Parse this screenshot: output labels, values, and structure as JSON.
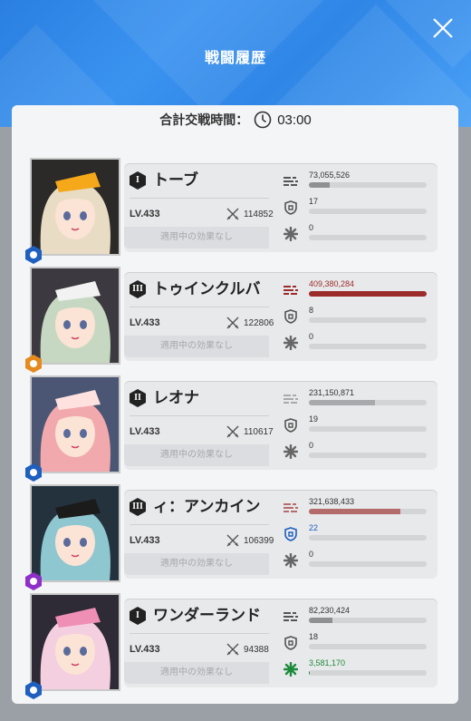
{
  "header": {
    "title": "戦闘履歴"
  },
  "summary": {
    "label": "合計交戦時間：",
    "time": "03:00"
  },
  "effect_text": "適用中の効果なし",
  "rows": [
    {
      "burst": "I",
      "name": "トーブ",
      "level": "LV.433",
      "power": "114852",
      "element": {
        "icon": "water-drop-icon",
        "color": "#1e5fbf"
      },
      "portrait": {
        "bg": "#2b2a28",
        "hair": "#e9dcc4",
        "accent": "#f4a81a"
      },
      "damage": {
        "value": "73,055,526",
        "fill": 0.18,
        "color": "#8f9093"
      },
      "taken": {
        "value": "17",
        "fill": 0.0,
        "color": "#8f9093"
      },
      "heal": {
        "value": "0",
        "fill": 0.0,
        "color": "#8f9093"
      }
    },
    {
      "burst": "III",
      "name": "トゥインクルバ",
      "level": "LV.433",
      "power": "122806",
      "element": {
        "icon": "iron-icon",
        "color": "#e58a1f"
      },
      "portrait": {
        "bg": "#3c3a40",
        "hair": "#c6d8c1",
        "accent": "#f2f2f2"
      },
      "damage": {
        "value": "409,380,284",
        "fill": 1.0,
        "color": "#9c2b2b"
      },
      "taken": {
        "value": "8",
        "fill": 0.0,
        "color": "#8f9093"
      },
      "heal": {
        "value": "0",
        "fill": 0.0,
        "color": "#8f9093"
      }
    },
    {
      "burst": "II",
      "name": "レオナ",
      "level": "LV.433",
      "power": "110617",
      "element": {
        "icon": "water-drop-icon",
        "color": "#1e5fbf"
      },
      "portrait": {
        "bg": "#4a5674",
        "hair": "#f2a9ad",
        "accent": "#ffe2e0"
      },
      "damage": {
        "value": "231,150,871",
        "fill": 0.56,
        "color": "#a8a9ac"
      },
      "taken": {
        "value": "19",
        "fill": 0.0,
        "color": "#8f9093"
      },
      "heal": {
        "value": "0",
        "fill": 0.0,
        "color": "#8f9093"
      }
    },
    {
      "burst": "III",
      "name": "ィ：アンカイン",
      "level": "LV.433",
      "power": "106399",
      "element": {
        "icon": "lightning-icon",
        "color": "#8e2fc9"
      },
      "portrait": {
        "bg": "#24323d",
        "hair": "#8fc7d1",
        "accent": "#1b1b1b"
      },
      "damage": {
        "value": "321,638,433",
        "fill": 0.78,
        "color": "#b46b6b"
      },
      "taken": {
        "value": "22",
        "fill": 0.0,
        "color": "#1e5fbf"
      },
      "heal": {
        "value": "0",
        "fill": 0.0,
        "color": "#8f9093"
      }
    },
    {
      "burst": "I",
      "name": "ワンダーランド",
      "level": "LV.433",
      "power": "94388",
      "element": {
        "icon": "water-drop-icon",
        "color": "#1e5fbf"
      },
      "portrait": {
        "bg": "#2e2a36",
        "hair": "#f3cfe0",
        "accent": "#f08fb5"
      },
      "damage": {
        "value": "82,230,424",
        "fill": 0.2,
        "color": "#8f9093"
      },
      "taken": {
        "value": "18",
        "fill": 0.0,
        "color": "#8f9093"
      },
      "heal": {
        "value": "3,581,170",
        "fill": 0.01,
        "color": "#1b8a3a"
      }
    }
  ],
  "colors": {
    "header_blue": "#2f86e6",
    "burst_badge": "#222222"
  }
}
